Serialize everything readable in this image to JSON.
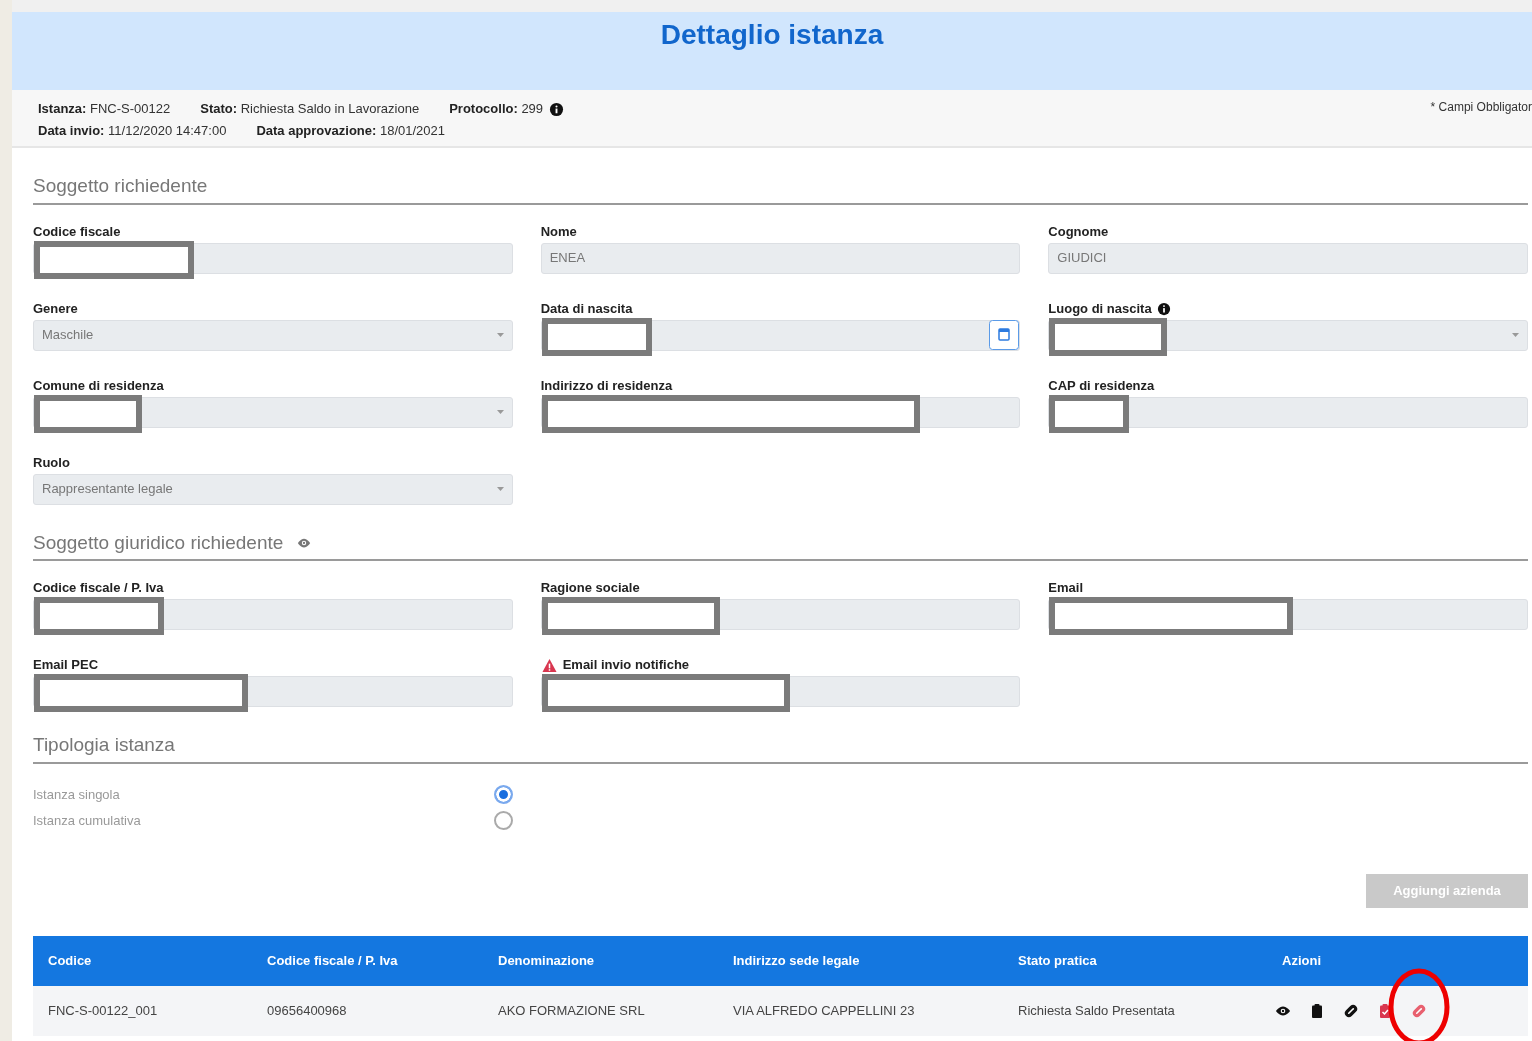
{
  "header": {
    "title": "Dettaglio istanza"
  },
  "info": {
    "lines": [
      [
        {
          "label": "Istanza:",
          "value": "FNC-S-00122"
        },
        {
          "label": "Stato:",
          "value": "Richiesta Saldo in Lavorazione"
        },
        {
          "label": "Protocollo:",
          "value": "299",
          "info": true
        }
      ],
      [
        {
          "label": "Data invio:",
          "value": "11/12/2020 14:47:00"
        },
        {
          "label": "Data approvazione:",
          "value": "18/01/2021"
        }
      ]
    ],
    "required_note": "* Campi Obbligator"
  },
  "sections": [
    {
      "title": "Soggetto richiedente",
      "fields": [
        {
          "label": "Codice fiscale",
          "kind": "text",
          "redacted": true
        },
        {
          "label": "Nome",
          "kind": "text",
          "value": "ENEA",
          "redacted": false
        },
        {
          "label": "Cognome",
          "kind": "text",
          "value": "GIUDICI",
          "redacted": false
        },
        {
          "label": "Genere",
          "kind": "select",
          "value": "Maschile",
          "redacted": false
        },
        {
          "label": "Data di nascita",
          "kind": "date",
          "redacted": true
        },
        {
          "label": "Luogo di nascita",
          "kind": "select",
          "redacted": true,
          "info": true
        },
        {
          "label": "Comune di residenza",
          "kind": "select",
          "redacted": true
        },
        {
          "label": "Indirizzo di residenza",
          "kind": "text",
          "redacted": true
        },
        {
          "label": "CAP di residenza",
          "kind": "text",
          "redacted": true
        },
        {
          "label": "Ruolo",
          "kind": "select",
          "value": "Rappresentante legale",
          "redacted": false
        }
      ]
    },
    {
      "title": "Soggetto giuridico richiedente",
      "eye": true,
      "fields": [
        {
          "label": "Codice fiscale / P. Iva",
          "kind": "text",
          "redacted": true
        },
        {
          "label": "Ragione sociale",
          "kind": "text",
          "redacted": true
        },
        {
          "label": "Email",
          "kind": "text",
          "redacted": true
        },
        {
          "label": "Email PEC",
          "kind": "text",
          "redacted": true
        },
        {
          "label": "Email invio notifiche",
          "kind": "text",
          "redacted": true,
          "warning": true
        }
      ]
    },
    {
      "title": "Tipologia istanza",
      "radios": [
        {
          "label": "Istanza singola",
          "selected": true
        },
        {
          "label": "Istanza cumulativa",
          "selected": false
        }
      ]
    }
  ],
  "add_button": {
    "label": "Aggiungi azienda",
    "disabled": true
  },
  "table": {
    "columns": [
      "Codice",
      "Codice fiscale / P. Iva",
      "Denominazione",
      "Indirizzo sede legale",
      "Stato pratica",
      "Azioni"
    ],
    "rows": [
      {
        "cells": [
          "FNC-S-00122_001",
          "09656400968",
          "AKO FORMAZIONE SRL",
          "VIA ALFREDO CAPPELLINI 23",
          "Richiesta Saldo Presentata"
        ],
        "actions": [
          {
            "kind": "view",
            "color": "#111111"
          },
          {
            "kind": "clipboard",
            "color": "#111111"
          },
          {
            "kind": "attach",
            "color": "#111111"
          },
          {
            "kind": "clipboard-check",
            "color": "#d9364f"
          },
          {
            "kind": "attach",
            "color": "#e8606f",
            "highlighted": true
          }
        ]
      }
    ]
  }
}
